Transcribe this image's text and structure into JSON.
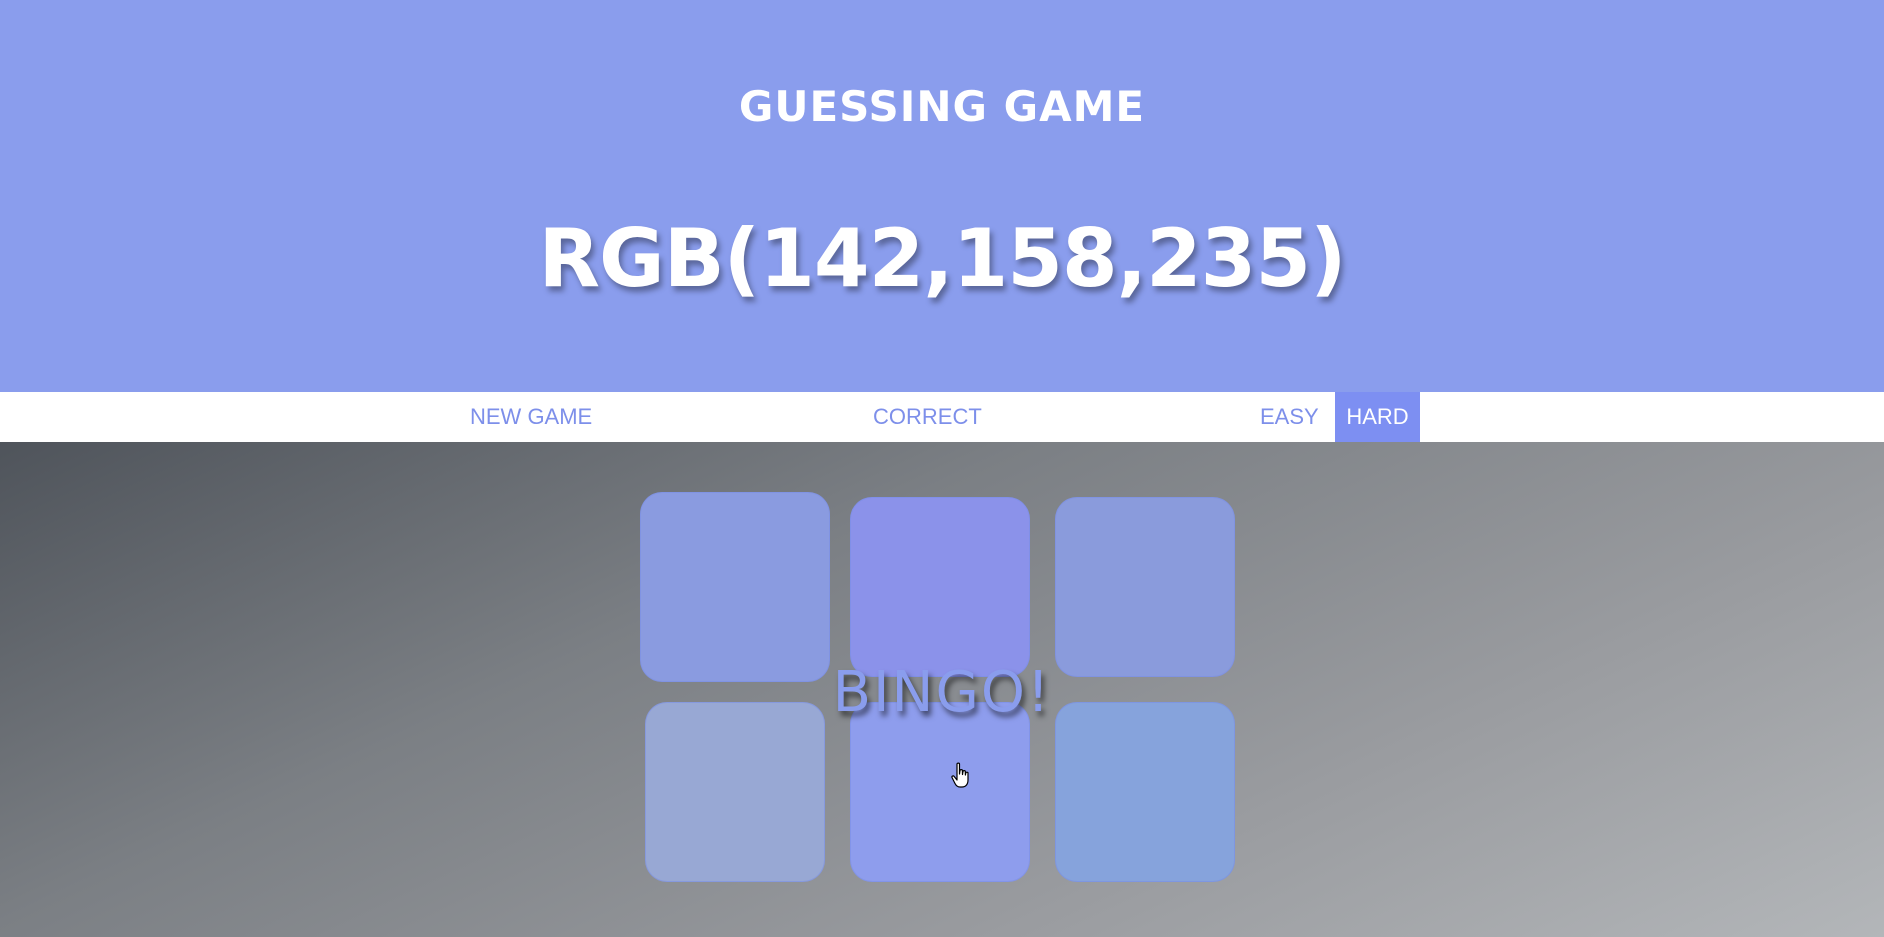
{
  "header": {
    "title": "GUESSING GAME",
    "target_color": "RGB(142,158,235)",
    "background_color": "#8a9ded"
  },
  "toolbar": {
    "new_game_label": "NEW GAME",
    "status_label": "CORRECT",
    "easy_label": "EASY",
    "hard_label": "HARD",
    "selected_mode": "HARD",
    "accent_color": "#7d8ff2"
  },
  "board": {
    "message": "BINGO!",
    "squares": [
      {
        "color": "#8a9be0"
      },
      {
        "color": "#8b92ea"
      },
      {
        "color": "#8a9bdc"
      },
      {
        "color": "#98a8d4"
      },
      {
        "color": "#8e9ded"
      },
      {
        "color": "#86a3dc"
      }
    ]
  }
}
